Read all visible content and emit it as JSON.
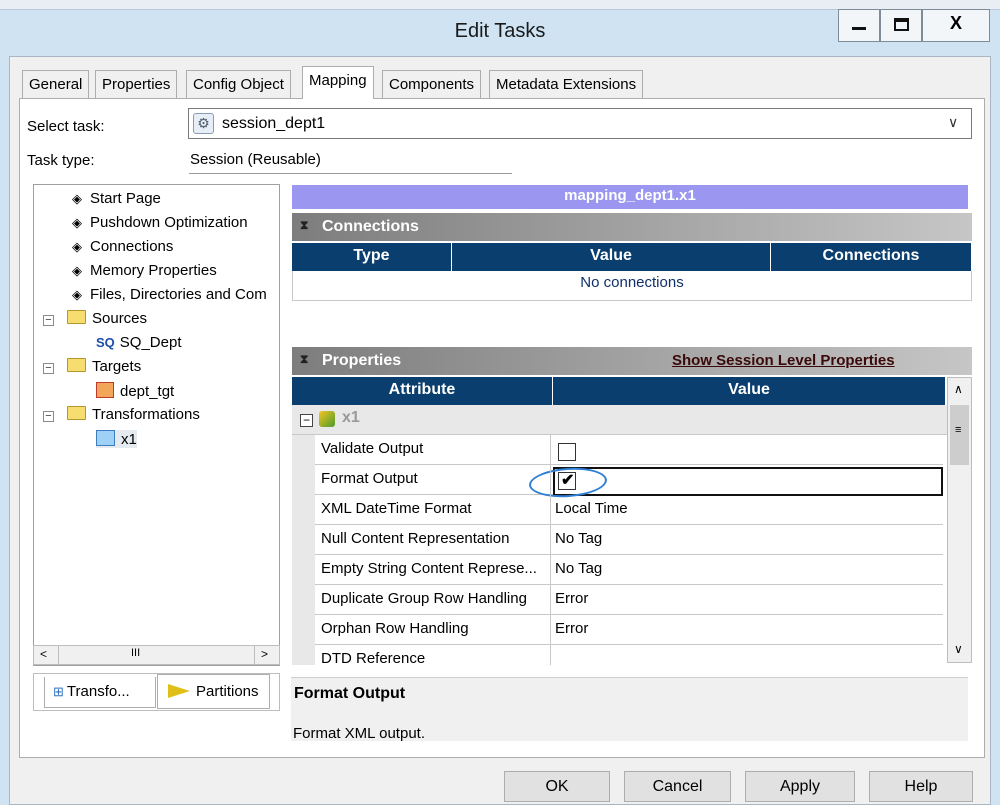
{
  "window": {
    "title": "Edit Tasks",
    "minimize_label": "—",
    "maximize_label": "☐",
    "close_label": "X"
  },
  "tabs": [
    "General",
    "Properties",
    "Config Object",
    "Mapping",
    "Components",
    "Metadata Extensions"
  ],
  "active_tab": "Mapping",
  "select_task": {
    "label": "Select task:",
    "value": "session_dept1"
  },
  "task_type": {
    "label": "Task type:",
    "value": "Session (Reusable)"
  },
  "tree": {
    "items": {
      "start_page": "Start Page",
      "pushdown": "Pushdown Optimization",
      "connections": "Connections",
      "memory": "Memory Properties",
      "files": "Files, Directories and Com",
      "sources": "Sources",
      "sq_dept_prefix": "SQ",
      "sq_dept": "SQ_Dept",
      "targets": "Targets",
      "dept_tgt": "dept_tgt",
      "transformations": "Transformations",
      "x1": "x1"
    },
    "scroll_mid": "III",
    "lower_tabs": [
      "Transfo...",
      "Partitions"
    ]
  },
  "mapping": {
    "title": "mapping_dept1.x1",
    "connections": {
      "section_title": "Connections",
      "columns": [
        "Type",
        "Value",
        "Connections"
      ],
      "empty_text": "No connections"
    },
    "properties": {
      "section_title": "Properties",
      "link": "Show Session Level Properties",
      "columns": [
        "Attribute",
        "Value"
      ],
      "group": "x1",
      "rows": [
        {
          "attribute": "Validate Output",
          "value": "",
          "checked": false
        },
        {
          "attribute": "Format Output",
          "value": "",
          "checked": true
        },
        {
          "attribute": "XML DateTime Format",
          "value": "Local Time"
        },
        {
          "attribute": "Null Content Representation",
          "value": "No Tag"
        },
        {
          "attribute": "Empty String Content Represe...",
          "value": "No Tag"
        },
        {
          "attribute": "Duplicate Group Row Handling",
          "value": "Error"
        },
        {
          "attribute": "Orphan Row Handling",
          "value": "Error"
        },
        {
          "attribute": "DTD Reference",
          "value": ""
        }
      ]
    }
  },
  "description": {
    "title": "Format Output",
    "text": "Format XML output."
  },
  "buttons": {
    "ok": "OK",
    "cancel": "Cancel",
    "apply": "Apply",
    "help": "Help"
  },
  "colors": {
    "header_navy": "#0a3e6e",
    "mapping_title_bg": "#9b96f0",
    "annotation_circle": "#2f7fd6"
  }
}
